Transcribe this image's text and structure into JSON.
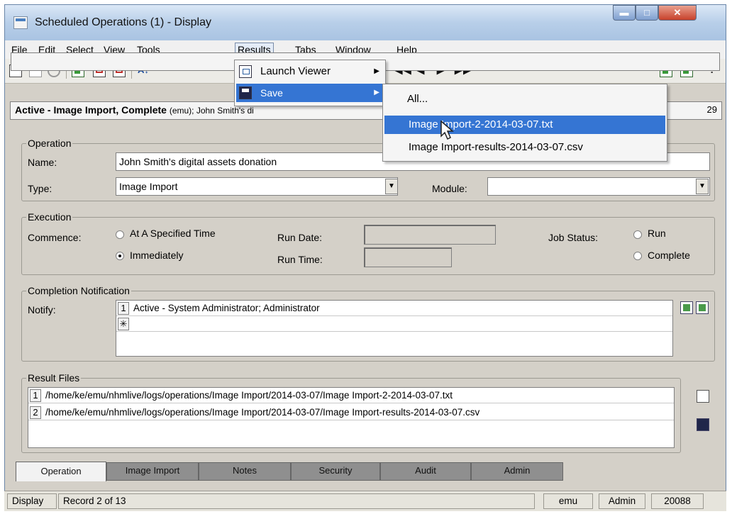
{
  "window": {
    "title": "Scheduled Operations (1) - Display"
  },
  "window_buttons": {
    "minimize": "▬",
    "maximize": "□",
    "close": "✕"
  },
  "menu": [
    "File",
    "Edit",
    "Select",
    "View",
    "Tools",
    "Results",
    "Tabs",
    "Window",
    "Help"
  ],
  "toolbar": {
    "sort_glyph": "A↓",
    "first": "◀◀",
    "prev": "◀",
    "next": "▶",
    "last": "▶▶",
    "help": "?"
  },
  "record": {
    "title": "Active - Image Import, Complete",
    "title_cut": "(emu); John Smith's di",
    "number": "29"
  },
  "operation": {
    "legend": "Operation",
    "name_label": "Name:",
    "name_value": "John Smith's digital assets donation",
    "type_label": "Type:",
    "type_value": "Image Import",
    "module_label": "Module:",
    "module_value": ""
  },
  "execution": {
    "legend": "Execution",
    "commence_label": "Commence:",
    "opt_specified": "At A Specified Time",
    "opt_immediately": "Immediately",
    "run_date_label": "Run Date:",
    "run_time_label": "Run Time:",
    "job_status_label": "Job Status:",
    "opt_run": "Run",
    "opt_complete": "Complete"
  },
  "notification": {
    "legend": "Completion Notification",
    "notify_label": "Notify:",
    "rows": [
      {
        "num": "1",
        "text": "Active - System Administrator; Administrator"
      }
    ],
    "new_row_marker": "✳"
  },
  "results": {
    "legend": "Result Files",
    "rows": [
      {
        "num": "1",
        "text": "/home/ke/emu/nhmlive/logs/operations/Image Import/2014-03-07/Image Import-2-2014-03-07.txt"
      },
      {
        "num": "2",
        "text": "/home/ke/emu/nhmlive/logs/operations/Image Import/2014-03-07/Image Import-results-2014-03-07.csv"
      }
    ]
  },
  "tabs": [
    "Operation",
    "Image Import",
    "Notes",
    "Security",
    "Audit",
    "Admin"
  ],
  "status": {
    "mode": "Display",
    "record": "Record 2 of 13",
    "user": "emu",
    "group": "Admin",
    "count": "20088"
  },
  "results_menu": {
    "items": [
      {
        "label": "Launch Viewer"
      },
      {
        "label": "Save"
      }
    ],
    "arrow": "▶"
  },
  "save_submenu": {
    "items": [
      "All...",
      "Image Import-2-2014-03-07.txt",
      "Image Import-results-2014-03-07.csv"
    ]
  }
}
